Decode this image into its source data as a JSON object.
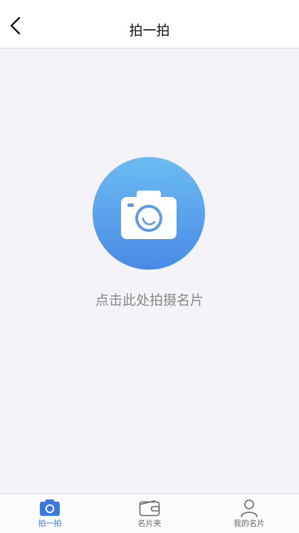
{
  "header": {
    "title": "拍一拍",
    "back_icon": "chevron-left-icon"
  },
  "main": {
    "camera_icon": "camera-icon",
    "hint": "点击此处拍摄名片",
    "circle_color_top": "#6bbcf3",
    "circle_color_bottom": "#4a8ae6"
  },
  "tabbar": {
    "accent_color": "#3b78e7",
    "active_index": 0,
    "tabs": [
      {
        "label": "拍一拍",
        "icon": "camera-icon"
      },
      {
        "label": "名片夹",
        "icon": "wallet-icon"
      },
      {
        "label": "我的名片",
        "icon": "person-icon"
      }
    ]
  }
}
